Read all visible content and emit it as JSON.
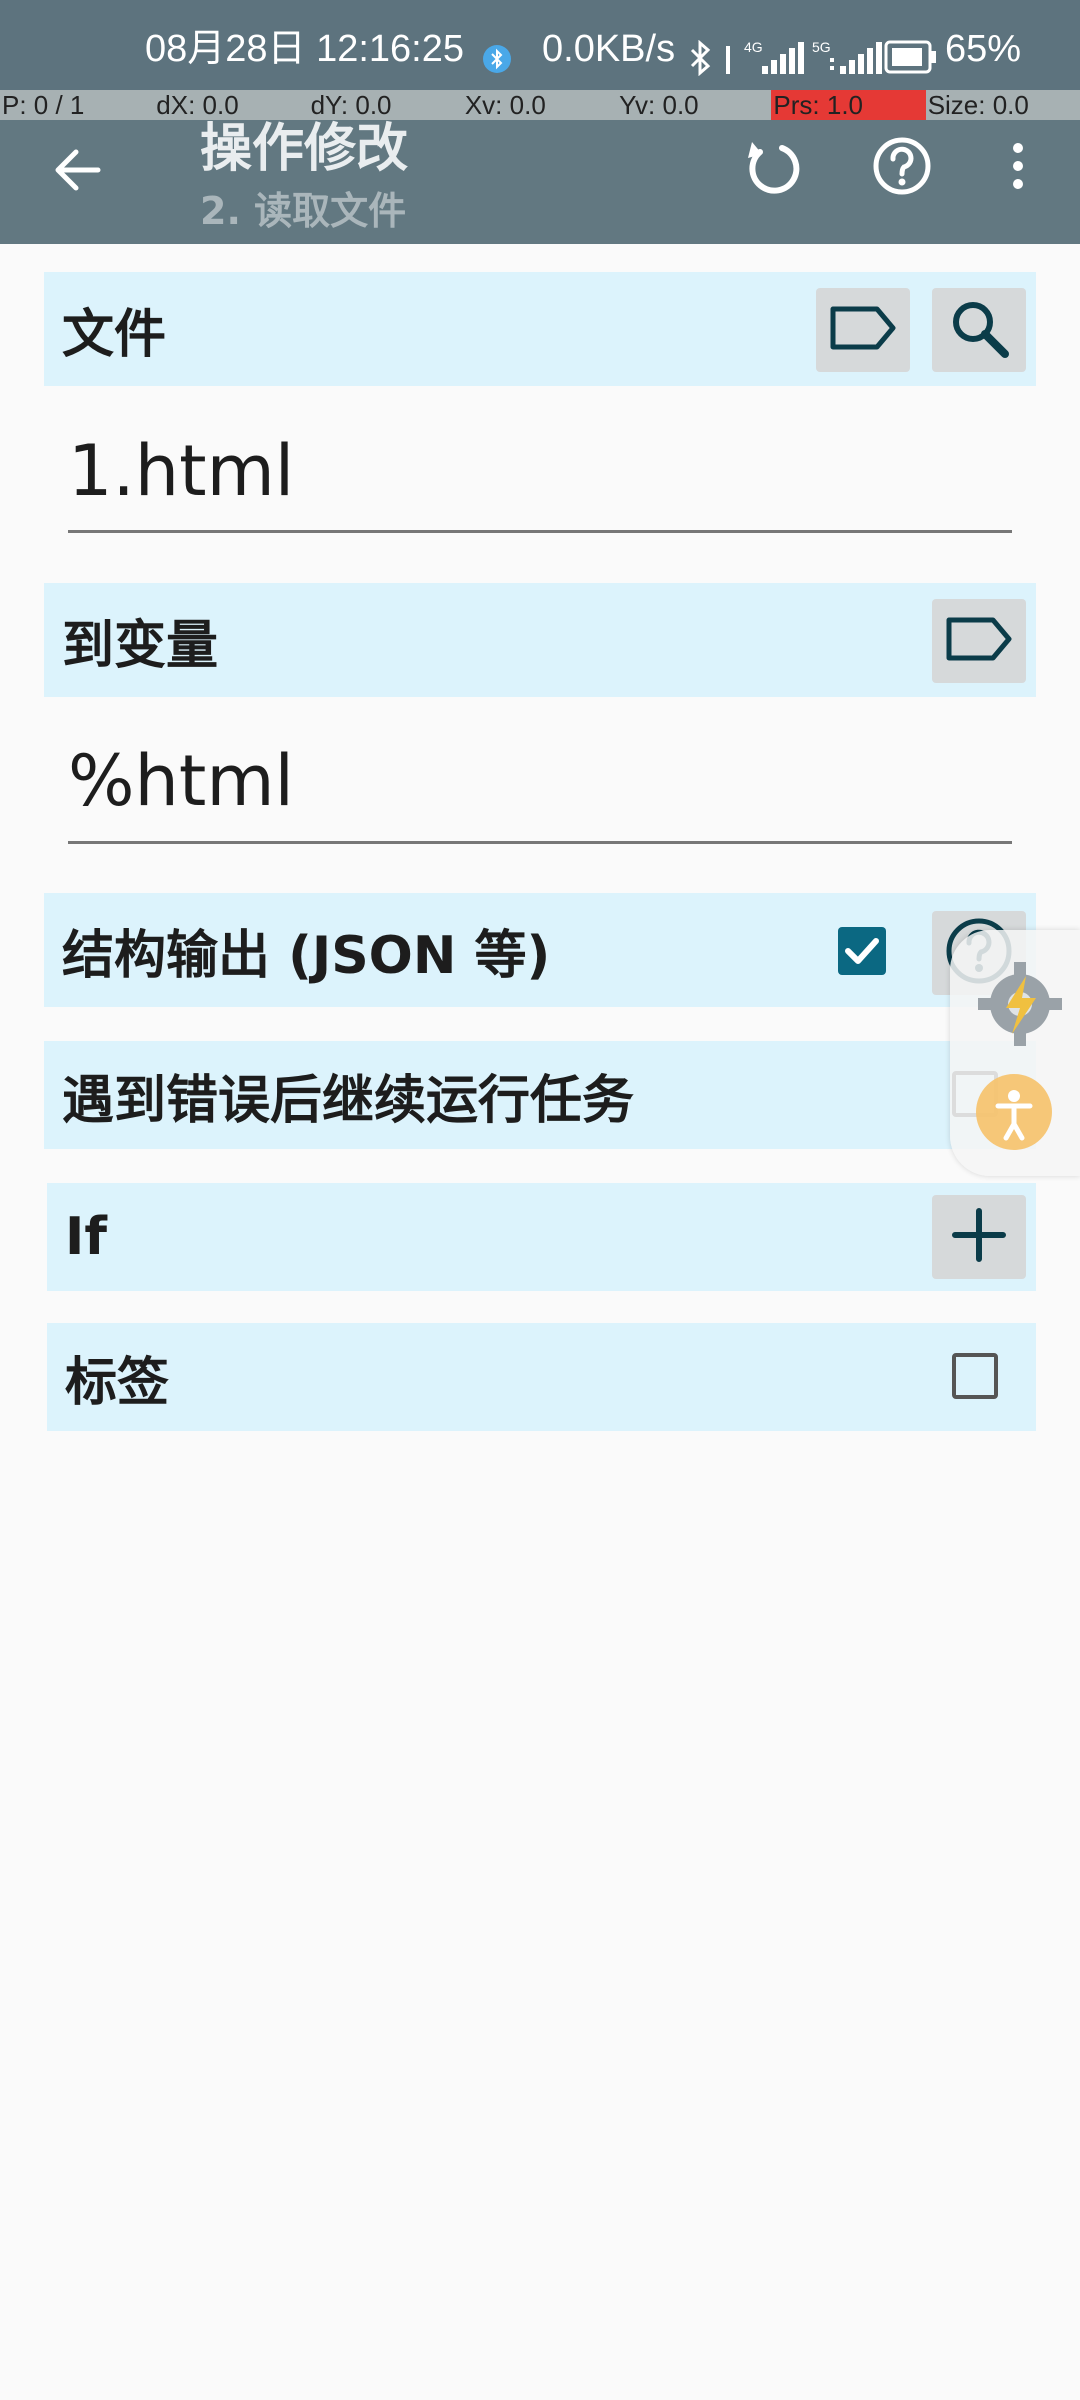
{
  "status_bar": {
    "time": "08月28日 12:16:25",
    "net_speed": "0.0KB/s",
    "battery": "65%"
  },
  "pointer_bar": {
    "cells": [
      "P: 0 / 1",
      "dX: 0.0",
      "dY: 0.0",
      "Xv: 0.0",
      "Yv: 0.0",
      "Prs: 1.0",
      "Size: 0.0"
    ]
  },
  "app_bar": {
    "title": "操作修改",
    "subtitle": "2. 读取文件"
  },
  "form": {
    "file_label": "文件",
    "file_value": "1.html",
    "var_label": "到变量",
    "var_value": "%html",
    "structured_label": "结构输出 (JSON 等)",
    "structured_checked": true,
    "continue_label": "遇到错误后继续运行任务",
    "continue_checked": false,
    "if_label": "If",
    "tag_label": "标签",
    "tag_checked": false
  },
  "colors": {
    "accent": "#0b6882",
    "row_bg": "#dcf3fc",
    "app_bar": "#627881"
  }
}
